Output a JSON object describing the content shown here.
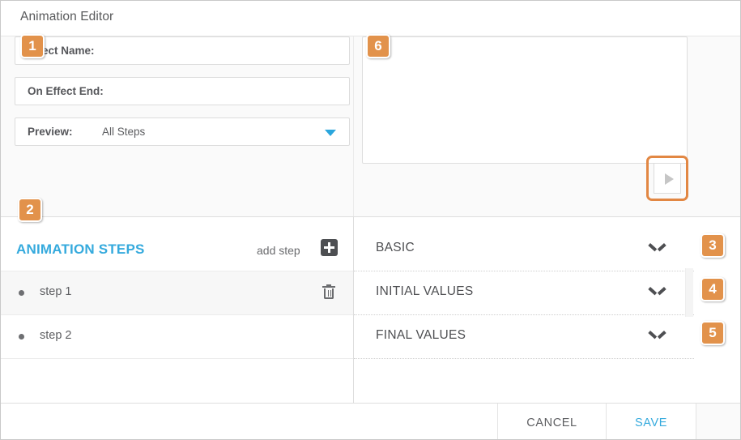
{
  "window": {
    "title": "Animation Editor"
  },
  "form": {
    "fields": [
      {
        "label": "Effect Name:",
        "value": ""
      },
      {
        "label": "On Effect End:",
        "value": ""
      },
      {
        "label": "Preview:",
        "value": "All Steps"
      }
    ]
  },
  "preview": {
    "play_icon": "play-triangle-icon",
    "highlighted": true
  },
  "steps_panel": {
    "heading": "ANIMATION STEPS",
    "add_step_label": "add step",
    "add_step_icon": "plus-square-icon",
    "delete_icon": "trash-icon",
    "steps": [
      {
        "label": "step 1",
        "selected": true,
        "deletable": true
      },
      {
        "label": "step 2",
        "selected": false,
        "deletable": false
      }
    ]
  },
  "properties_panel": {
    "sections": [
      {
        "label": "BASIC",
        "chevron": "chevron-down-icon",
        "expanded": false
      },
      {
        "label": "INITIAL VALUES",
        "chevron": "chevron-down-icon",
        "expanded": false
      },
      {
        "label": "FINAL VALUES",
        "chevron": "chevron-down-icon",
        "expanded": false
      }
    ]
  },
  "footer": {
    "cancel_label": "CANCEL",
    "save_label": "SAVE"
  },
  "callouts": [
    {
      "number": "1"
    },
    {
      "number": "2"
    },
    {
      "number": "3"
    },
    {
      "number": "4"
    },
    {
      "number": "5"
    },
    {
      "number": "6"
    }
  ],
  "colors": {
    "badge": "#e2924b",
    "accent_blue": "#35aadd",
    "highlight_orange": "#e28743",
    "text_dark": "#55565a"
  }
}
